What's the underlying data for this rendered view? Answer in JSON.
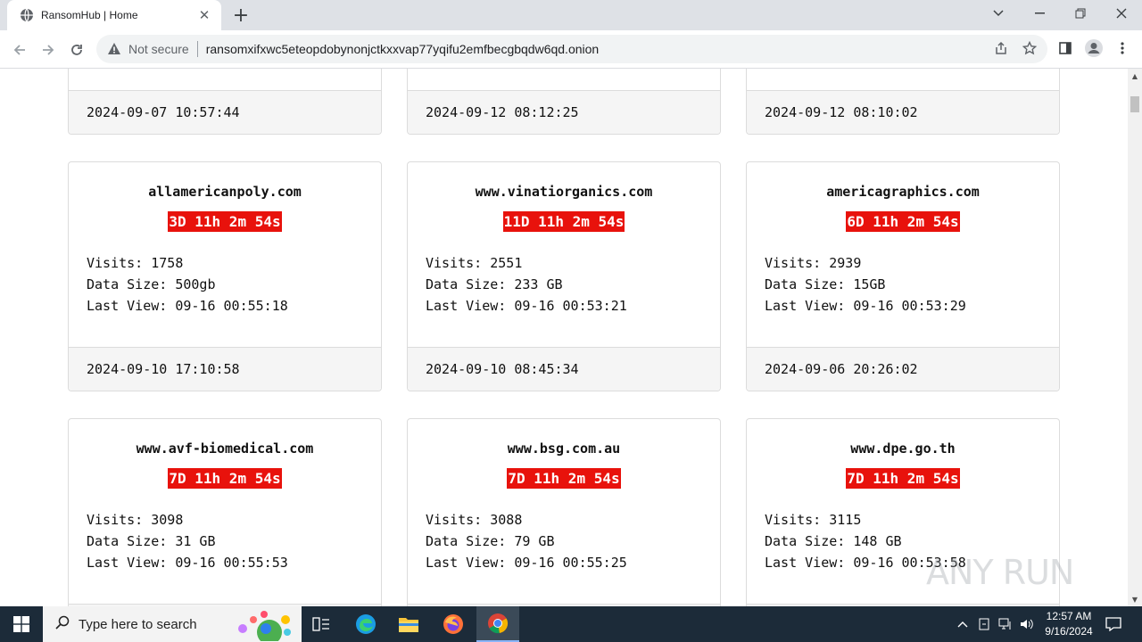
{
  "browser": {
    "tab_title": "RansomHub | Home",
    "security_label": "Not secure",
    "url": "ransomxifxwc5eteopdobynonjctkxxvap77yqifu2emfbecgbqdw6qd.onion"
  },
  "top_cards": [
    {
      "date": "2024-09-07 10:57:44"
    },
    {
      "date": "2024-09-12 08:12:25"
    },
    {
      "date": "2024-09-12 08:10:02"
    }
  ],
  "cards": [
    {
      "title": "allamericanpoly.com",
      "timer": "3D 11h 2m 54s",
      "visits": "Visits: 1758",
      "size": "Data Size: 500gb",
      "last_view": "Last View: 09-16 00:55:18",
      "date": "2024-09-10 17:10:58"
    },
    {
      "title": "www.vinatiorganics.com",
      "timer": "11D 11h 2m 54s",
      "visits": "Visits: 2551",
      "size": "Data Size: 233 GB",
      "last_view": "Last View: 09-16 00:53:21",
      "date": "2024-09-10 08:45:34"
    },
    {
      "title": "americagraphics.com",
      "timer": "6D 11h 2m 54s",
      "visits": "Visits: 2939",
      "size": "Data Size: 15GB",
      "last_view": "Last View: 09-16 00:53:29",
      "date": "2024-09-06 20:26:02"
    },
    {
      "title": "www.avf-biomedical.com",
      "timer": "7D 11h 2m 54s",
      "visits": "Visits: 3098",
      "size": "Data Size: 31 GB",
      "last_view": "Last View: 09-16 00:55:53",
      "date": ""
    },
    {
      "title": "www.bsg.com.au",
      "timer": "7D 11h 2m 54s",
      "visits": "Visits: 3088",
      "size": "Data Size: 79 GB",
      "last_view": "Last View: 09-16 00:55:25",
      "date": ""
    },
    {
      "title": "www.dpe.go.th",
      "timer": "7D 11h 2m 54s",
      "visits": "Visits: 3115",
      "size": "Data Size: 148 GB",
      "last_view": "Last View: 09-16 00:53:58",
      "date": ""
    }
  ],
  "taskbar": {
    "search_placeholder": "Type here to search",
    "time": "12:57 AM",
    "date": "9/16/2024"
  },
  "watermark_text": "ANY RUN",
  "icons": [
    "globe-icon",
    "close-icon",
    "plus-icon",
    "back-icon",
    "forward-icon",
    "reload-icon",
    "warning-icon",
    "share-icon",
    "star-icon",
    "sidepanel-icon",
    "profile-icon",
    "menu-icon",
    "windows-icon",
    "search-icon",
    "task-view-icon",
    "edge-icon",
    "file-explorer-icon",
    "firefox-icon",
    "chrome-icon"
  ],
  "colors": {
    "timer_bg": "#e8120c",
    "taskbar": "#1c2b39",
    "tabstrip": "#dee1e6"
  }
}
